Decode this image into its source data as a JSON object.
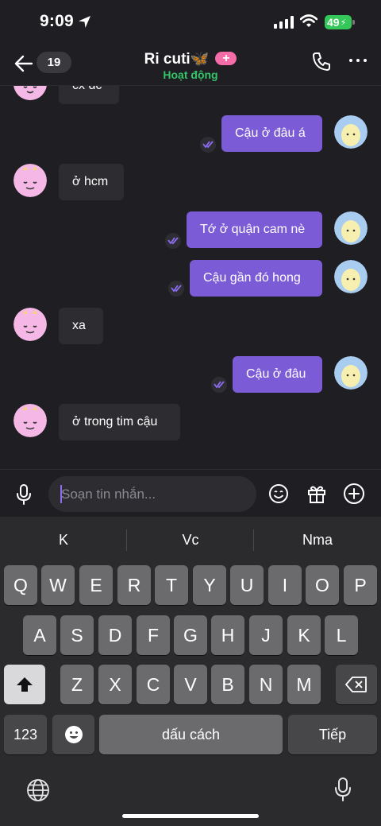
{
  "status_bar": {
    "time": "9:09",
    "battery": "49"
  },
  "header": {
    "unread_count": "19",
    "contact_name": "Ri cuti",
    "name_emoji": "🦋",
    "status": "Hoạt động"
  },
  "messages": [
    {
      "from": "them",
      "text": "cx dc"
    },
    {
      "from": "me",
      "text": "Cậu ở đâu á"
    },
    {
      "from": "them",
      "text": "ở hcm"
    },
    {
      "from": "me",
      "text": "Tớ ở quận cam nè"
    },
    {
      "from": "me",
      "text": "Cậu gần đó hong"
    },
    {
      "from": "them",
      "text": "xa"
    },
    {
      "from": "me",
      "text": "Cậu ở đâu"
    },
    {
      "from": "them",
      "text": "ở trong tim cậu"
    }
  ],
  "composer": {
    "placeholder": "Soạn tin nhắn..."
  },
  "keyboard": {
    "suggestions": [
      "K",
      "Vc",
      "Nma"
    ],
    "row1": [
      "Q",
      "W",
      "E",
      "R",
      "T",
      "Y",
      "U",
      "I",
      "O",
      "P"
    ],
    "row2": [
      "A",
      "S",
      "D",
      "F",
      "G",
      "H",
      "J",
      "K",
      "L"
    ],
    "row3": [
      "Z",
      "X",
      "C",
      "V",
      "B",
      "N",
      "M"
    ],
    "numbers_label": "123",
    "space_label": "dấu cách",
    "return_label": "Tiếp"
  },
  "colors": {
    "accent": "#7c5bd6",
    "online": "#35c46a",
    "pill_pink": "#f46ca8"
  }
}
